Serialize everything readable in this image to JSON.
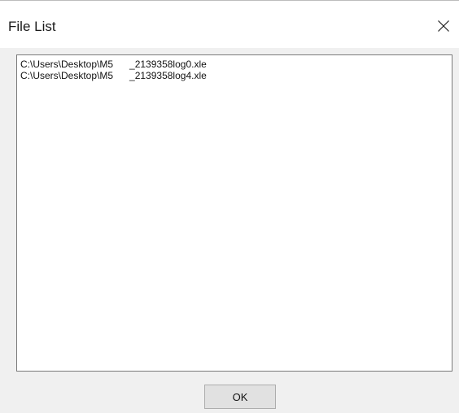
{
  "window": {
    "title": "File List"
  },
  "file_list": {
    "items": [
      "C:\\Users\\Desktop\\M5      _2139358log0.xle",
      "C:\\Users\\Desktop\\M5      _2139358log4.xle"
    ]
  },
  "buttons": {
    "ok_label": "OK",
    "close_icon": "close-icon"
  }
}
